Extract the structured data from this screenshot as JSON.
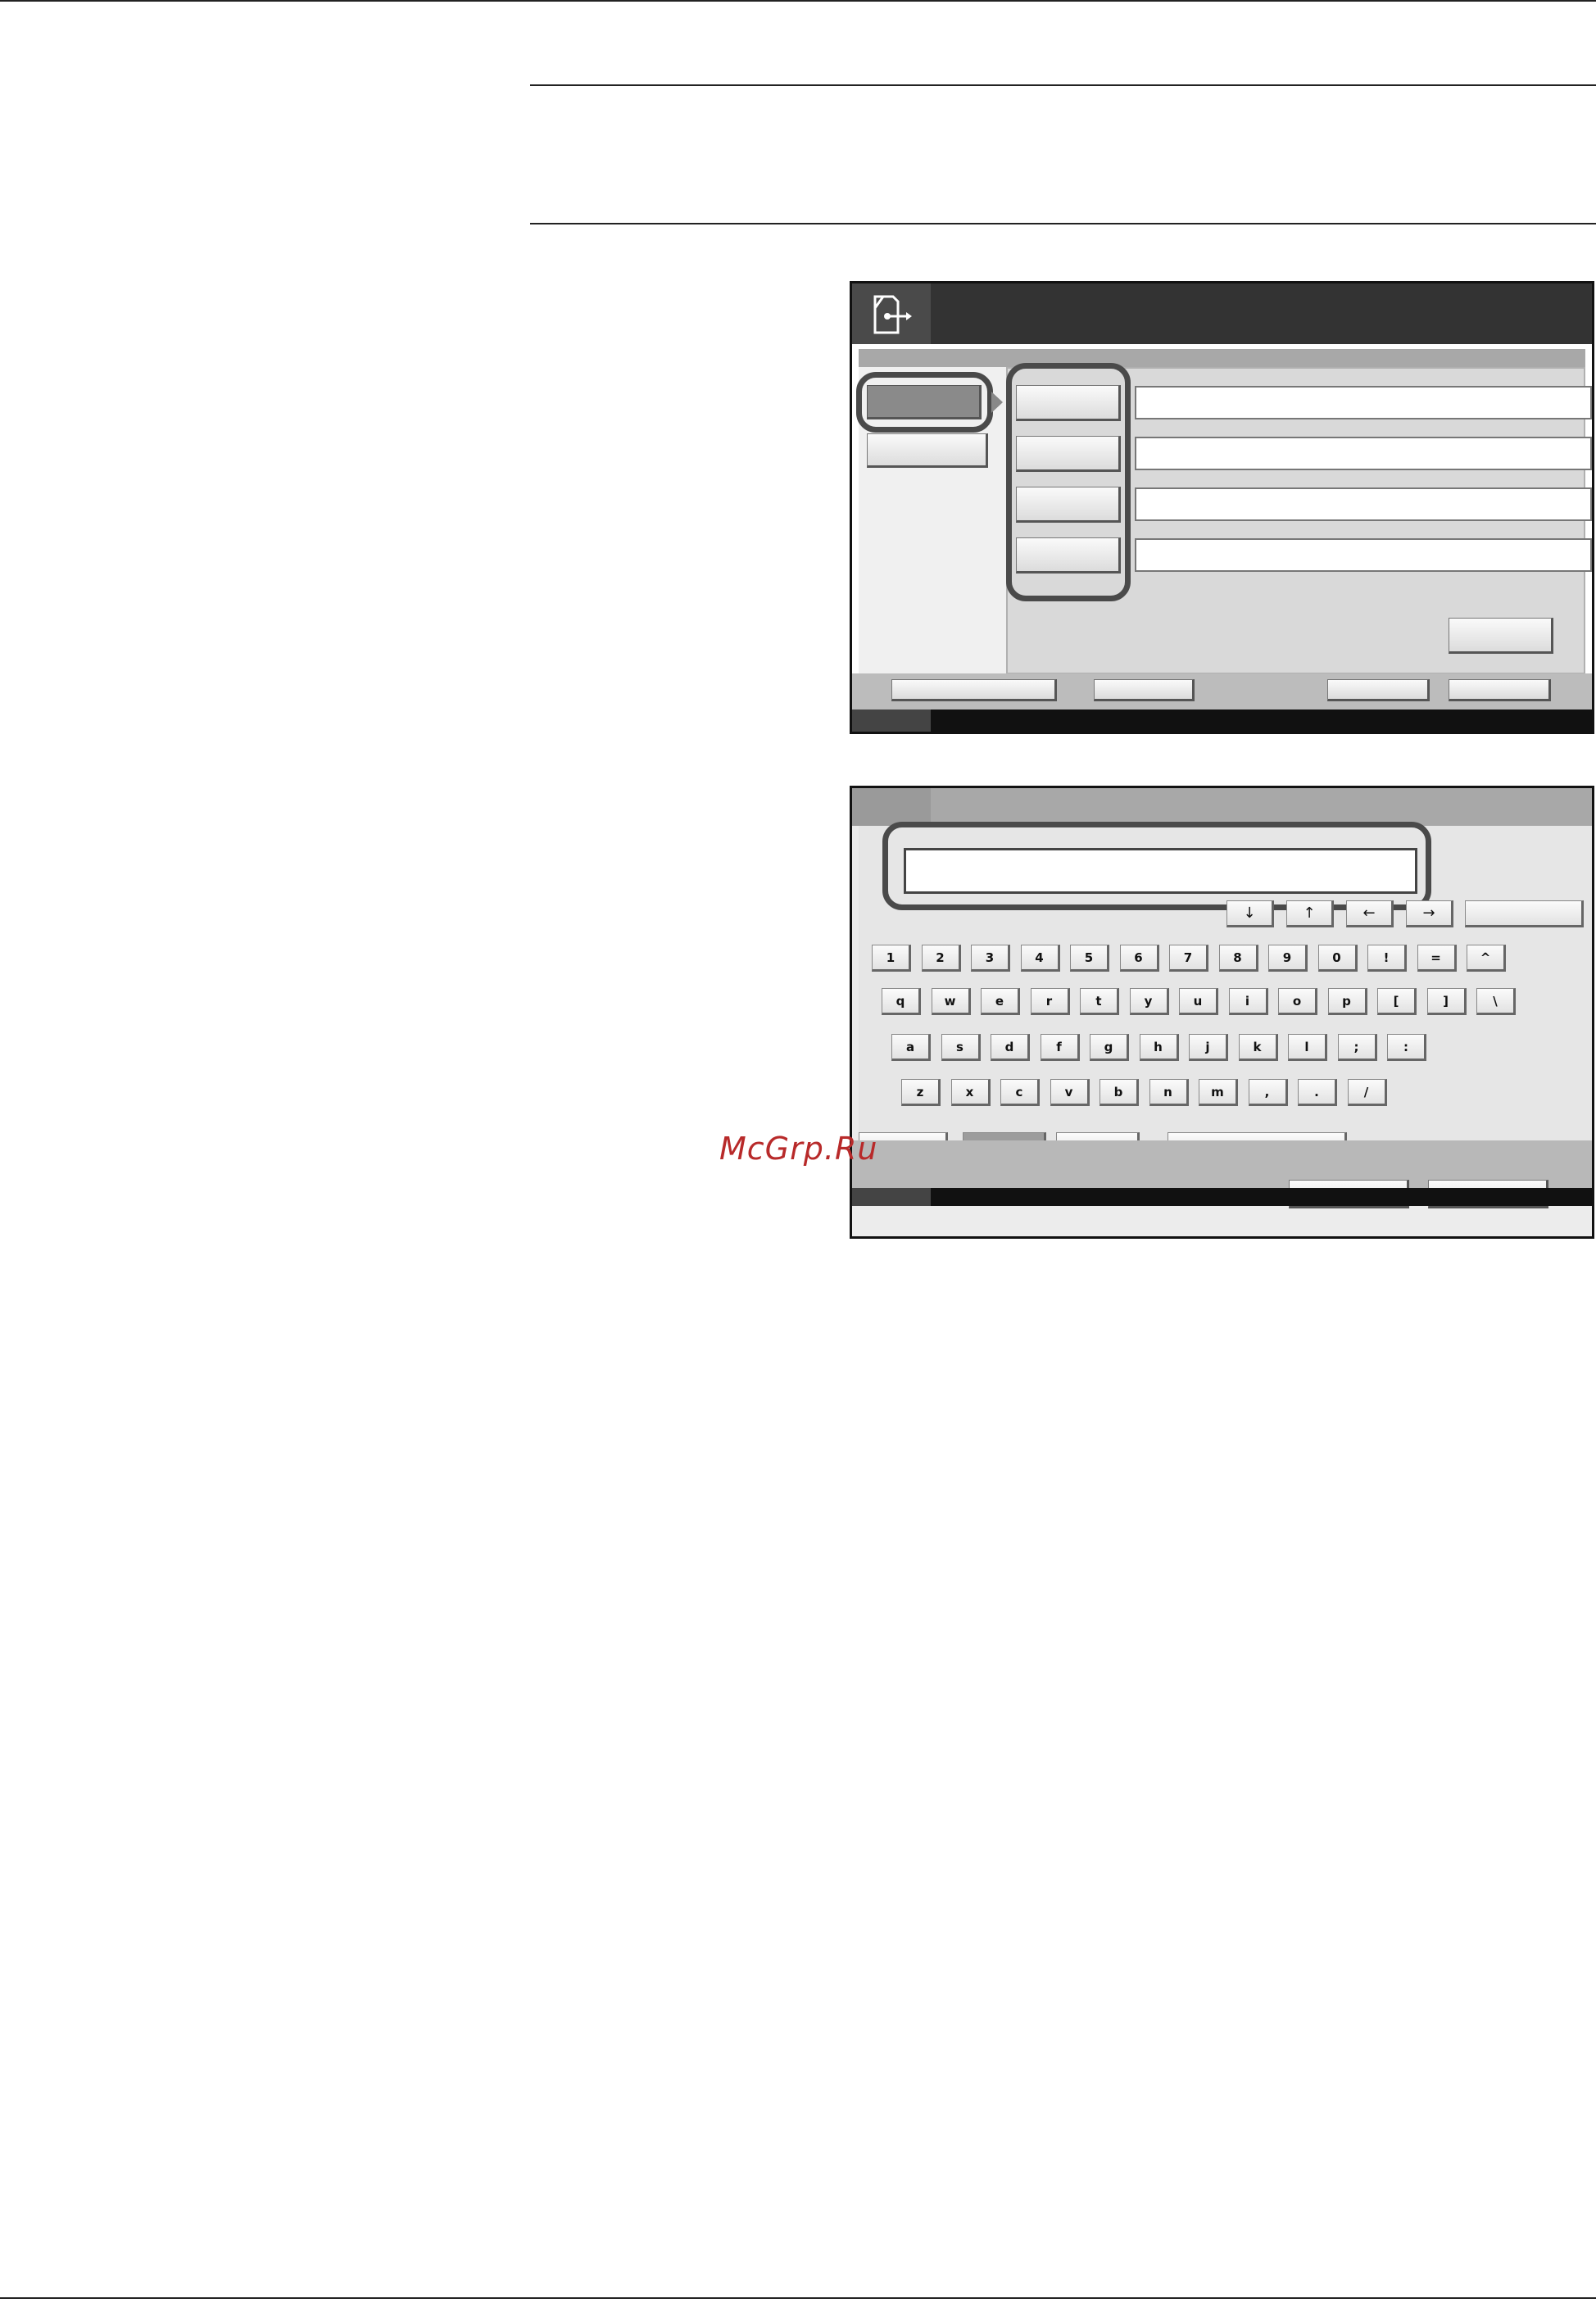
{
  "watermark": "McGrp.Ru",
  "panel1": {
    "header_icon": "send-document-icon",
    "left_tabs": [
      "",
      ""
    ],
    "field_rows": [
      {
        "button": "",
        "value": ""
      },
      {
        "button": "",
        "value": ""
      },
      {
        "button": "",
        "value": ""
      },
      {
        "button": "",
        "value": ""
      }
    ],
    "footer_buttons": [
      "",
      "",
      "",
      ""
    ]
  },
  "panel2": {
    "text_input_value": "",
    "arrow_keys": [
      "↓",
      "↑",
      "←",
      "→"
    ],
    "rows": [
      [
        "1",
        "2",
        "3",
        "4",
        "5",
        "6",
        "7",
        "8",
        "9",
        "0",
        "!",
        "=",
        "^"
      ],
      [
        "q",
        "w",
        "e",
        "r",
        "t",
        "y",
        "u",
        "i",
        "o",
        "p",
        "[",
        "]",
        "\\"
      ],
      [
        "a",
        "s",
        "d",
        "f",
        "g",
        "h",
        "j",
        "k",
        "l",
        ";",
        ":"
      ],
      [
        "z",
        "x",
        "c",
        "v",
        "b",
        "n",
        "m",
        ",",
        ".",
        "/"
      ]
    ]
  }
}
